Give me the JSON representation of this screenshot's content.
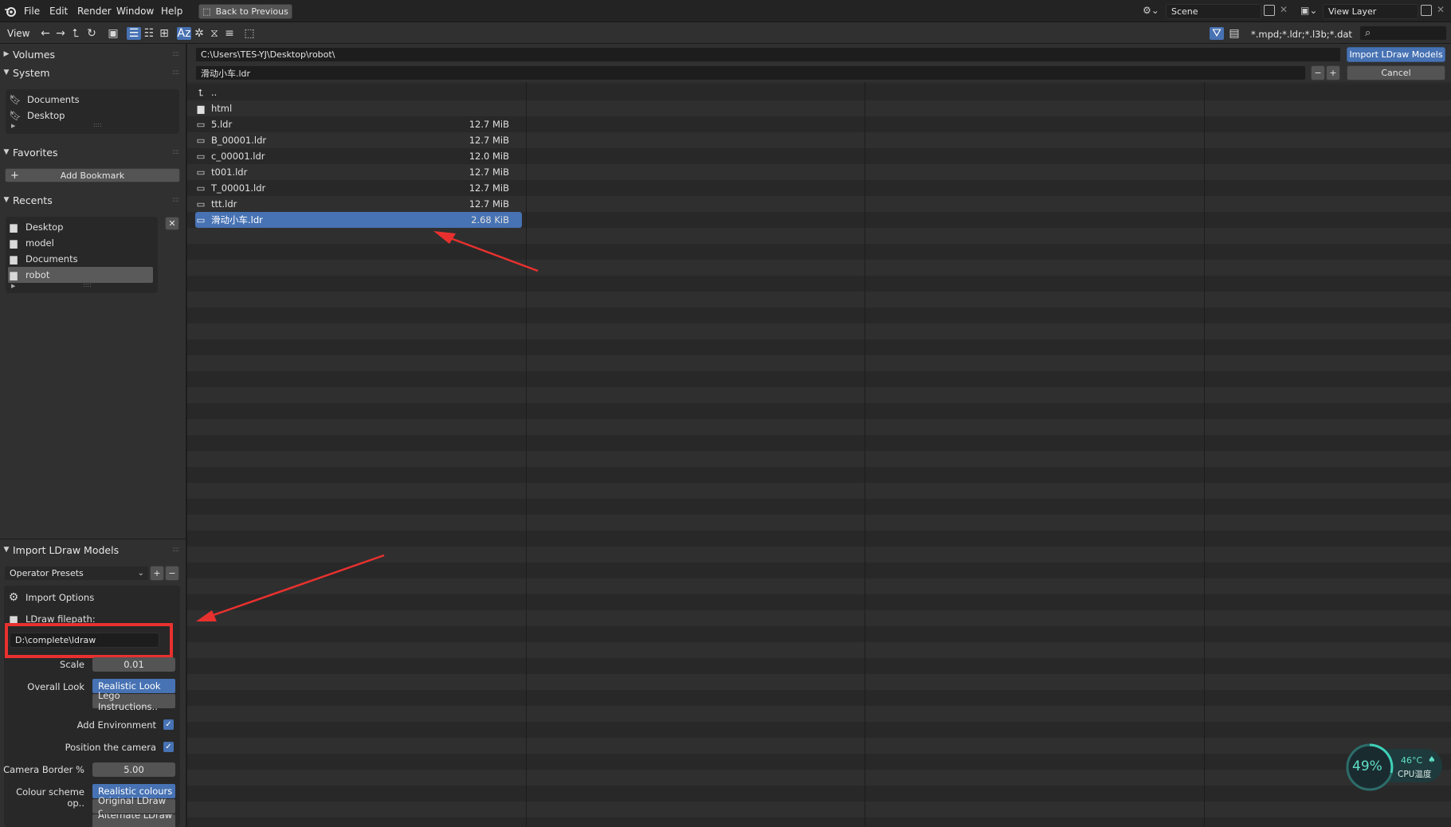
{
  "menubar": {
    "items": [
      "File",
      "Edit",
      "Render",
      "Window",
      "Help"
    ],
    "back_button": "Back to Previous",
    "scene_label": "Scene",
    "view_layer_label": "View Layer"
  },
  "toolbar": {
    "view_label": "View",
    "filter_text": "*.mpd;*.ldr;*.l3b;*.dat"
  },
  "path": {
    "directory": "C:\\Users\\TES-YJ\\Desktop\\robot\\",
    "filename": "滑动小车.ldr",
    "import_button": "Import LDraw Models",
    "cancel_button": "Cancel"
  },
  "sidebar": {
    "volumes_title": "Volumes",
    "system_title": "System",
    "system_items": [
      "Documents",
      "Desktop"
    ],
    "favorites_title": "Favorites",
    "add_bookmark": "Add Bookmark",
    "recents_title": "Recents",
    "recent_items": [
      "Desktop",
      "model",
      "Documents",
      "robot"
    ],
    "import_panel_title": "Import LDraw Models",
    "operator_presets": "Operator Presets",
    "import_options": "Import Options",
    "ldraw_filepath_label": "LDraw filepath:",
    "ldraw_filepath_value": "D:\\complete\\ldraw",
    "scale_label": "Scale",
    "scale_value": "0.01",
    "overall_look_label": "Overall Look",
    "overall_look_options": [
      "Realistic Look",
      "Lego Instructions.."
    ],
    "add_environment_label": "Add Environment",
    "position_camera_label": "Position the camera",
    "camera_border_label": "Camera Border %",
    "camera_border_value": "5.00",
    "colour_scheme_label": "Colour scheme op..",
    "colour_scheme_options": [
      "Realistic colours",
      "Original LDraw c..",
      "Alternate LDraw .."
    ]
  },
  "files": [
    {
      "name": "..",
      "size": "",
      "type": "parent"
    },
    {
      "name": "html",
      "size": "",
      "type": "folder"
    },
    {
      "name": "5.ldr",
      "size": "12.7 MiB",
      "type": "file"
    },
    {
      "name": "B_00001.ldr",
      "size": "12.7 MiB",
      "type": "file"
    },
    {
      "name": "c_00001.ldr",
      "size": "12.0 MiB",
      "type": "file"
    },
    {
      "name": "t001.ldr",
      "size": "12.7 MiB",
      "type": "file"
    },
    {
      "name": "T_00001.ldr",
      "size": "12.7 MiB",
      "type": "file"
    },
    {
      "name": "ttt.ldr",
      "size": "12.7 MiB",
      "type": "file"
    },
    {
      "name": "滑动小车.ldr",
      "size": "2.68 KiB",
      "type": "file",
      "selected": true
    }
  ],
  "cpu_widget": {
    "percent": "49%",
    "temperature": "46°C",
    "label": "CPU温度"
  },
  "colors": {
    "accent": "#4772b3",
    "annotation": "#e8312f"
  }
}
